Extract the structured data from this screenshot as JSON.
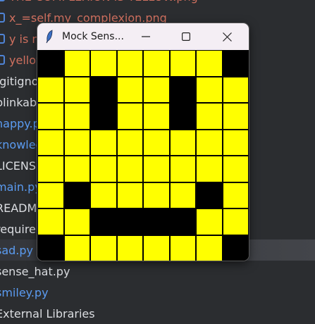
{
  "project_tree": {
    "items": [
      {
        "label": "THE COMPLEXION IS YELLOW.png",
        "color": "red",
        "icon": "image-file-icon"
      },
      {
        "label": "x_=self.my_complexion.png",
        "color": "red",
        "icon": "image-file-icon"
      },
      {
        "label": "y is n",
        "color": "red",
        "icon": "image-file-icon"
      },
      {
        "label": "yellow",
        "color": "red",
        "icon": "image-file-icon"
      },
      {
        "label": ".gitignore",
        "color": "white"
      },
      {
        "label": "blinkable",
        "color": "white"
      },
      {
        "label": "happy.py",
        "color": "blue"
      },
      {
        "label": "knowledge",
        "color": "blue"
      },
      {
        "label": "LICENSE",
        "color": "white"
      },
      {
        "label": "main.py",
        "color": "blue"
      },
      {
        "label": "README",
        "color": "white"
      },
      {
        "label": "requirements",
        "color": "white"
      },
      {
        "label": "sad.py",
        "color": "blue",
        "selected": true
      },
      {
        "label": "sense_hat.py",
        "color": "white"
      },
      {
        "label": "smiley.py",
        "color": "blue"
      },
      {
        "label": "External Libraries",
        "color": "white"
      }
    ]
  },
  "window": {
    "title": "Mock Sens...",
    "icon": "tk-feather-icon",
    "minimize": "—",
    "maximize": "☐",
    "close": "✕"
  },
  "led_matrix": {
    "on_color": "#ffff00",
    "off_color": "#000000",
    "rows": [
      [
        0,
        1,
        1,
        1,
        1,
        1,
        1,
        0
      ],
      [
        1,
        1,
        0,
        1,
        1,
        0,
        1,
        1
      ],
      [
        1,
        1,
        0,
        1,
        1,
        0,
        1,
        1
      ],
      [
        1,
        1,
        1,
        1,
        1,
        1,
        1,
        1
      ],
      [
        1,
        1,
        1,
        1,
        1,
        1,
        1,
        1
      ],
      [
        1,
        0,
        1,
        1,
        1,
        1,
        0,
        1
      ],
      [
        1,
        1,
        0,
        0,
        0,
        0,
        1,
        1
      ],
      [
        0,
        1,
        1,
        1,
        1,
        1,
        1,
        0
      ]
    ]
  }
}
